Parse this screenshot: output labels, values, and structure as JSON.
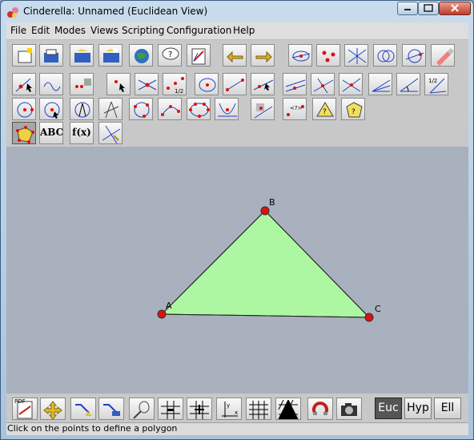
{
  "window": {
    "title": "Cinderella: Unnamed (Euclidean View)"
  },
  "menu": [
    "File",
    "Edit",
    "Modes",
    "Views",
    "Scripting",
    "Configuration",
    "Help"
  ],
  "toolbar_row1": [
    {
      "name": "new-icon"
    },
    {
      "name": "open-icon"
    },
    {
      "name": "save-icon"
    },
    {
      "name": "save-as-icon"
    },
    {
      "name": "globe-icon"
    },
    {
      "name": "info-icon"
    },
    {
      "name": "export-icon"
    },
    {
      "name": "undo-icon"
    },
    {
      "name": "redo-icon"
    },
    {
      "name": "select-lines-icon"
    },
    {
      "name": "select-points-icon"
    },
    {
      "name": "select-all-lines-icon"
    },
    {
      "name": "select-circles-icon"
    },
    {
      "name": "select-conics-icon"
    },
    {
      "name": "delete-icon"
    }
  ],
  "toolbar_row2": [
    {
      "name": "move-icon"
    },
    {
      "name": "draw-curve-icon"
    },
    {
      "name": "multiple-points-icon"
    },
    {
      "name": "add-point-icon"
    },
    {
      "name": "intersection-icon"
    },
    {
      "name": "midpoint-icon"
    },
    {
      "name": "circle-center-icon"
    },
    {
      "name": "segment-icon"
    },
    {
      "name": "line-icon"
    },
    {
      "name": "parallel-icon"
    },
    {
      "name": "perpendicular-icon"
    },
    {
      "name": "line-through-icon"
    },
    {
      "name": "angle-bisector-icon"
    },
    {
      "name": "angle-icon"
    },
    {
      "name": "fraction-icon"
    }
  ],
  "toolbar_row3": [
    {
      "name": "circle-by-radius-icon"
    },
    {
      "name": "circle-icon"
    },
    {
      "name": "compass-icon"
    },
    {
      "name": "compass-construction-icon"
    },
    {
      "name": "circle-three-points-icon"
    },
    {
      "name": "arc-icon"
    },
    {
      "name": "conic-five-points-icon"
    },
    {
      "name": "parabola-icon"
    },
    {
      "name": "locus-icon"
    },
    {
      "name": "distance-icon"
    },
    {
      "name": "measure-angle-icon"
    },
    {
      "name": "question-polygon-icon"
    }
  ],
  "toolbar_row4": [
    {
      "name": "polygon-icon",
      "active": true
    },
    {
      "name": "text-icon",
      "label": "ABC"
    },
    {
      "name": "function-icon",
      "label": "f(x)"
    },
    {
      "name": "transform-icon"
    }
  ],
  "canvas": {
    "fill_color": "#aef7a2",
    "point_color": "#e01010",
    "points": [
      {
        "label": "A"
      },
      {
        "label": "B"
      },
      {
        "label": "C"
      }
    ]
  },
  "bottom_toolbar": [
    {
      "name": "pdf-export-icon",
      "label": "PDF"
    },
    {
      "name": "pan-arrows-icon"
    },
    {
      "name": "zoom-in-icon"
    },
    {
      "name": "zoom-out-icon"
    },
    {
      "name": "tennis-racket-icon"
    },
    {
      "name": "snap-grid-icon"
    },
    {
      "name": "snap-cross-icon"
    },
    {
      "name": "axes-icon"
    },
    {
      "name": "grid-icon"
    },
    {
      "name": "triangular-grid-icon"
    },
    {
      "name": "magnet-icon"
    },
    {
      "name": "camera-icon"
    }
  ],
  "geometry": [
    {
      "label": "Euc",
      "active": true
    },
    {
      "label": "Hyp",
      "active": false
    },
    {
      "label": "Ell",
      "active": false
    }
  ],
  "status": "Click on the points to define a polygon"
}
